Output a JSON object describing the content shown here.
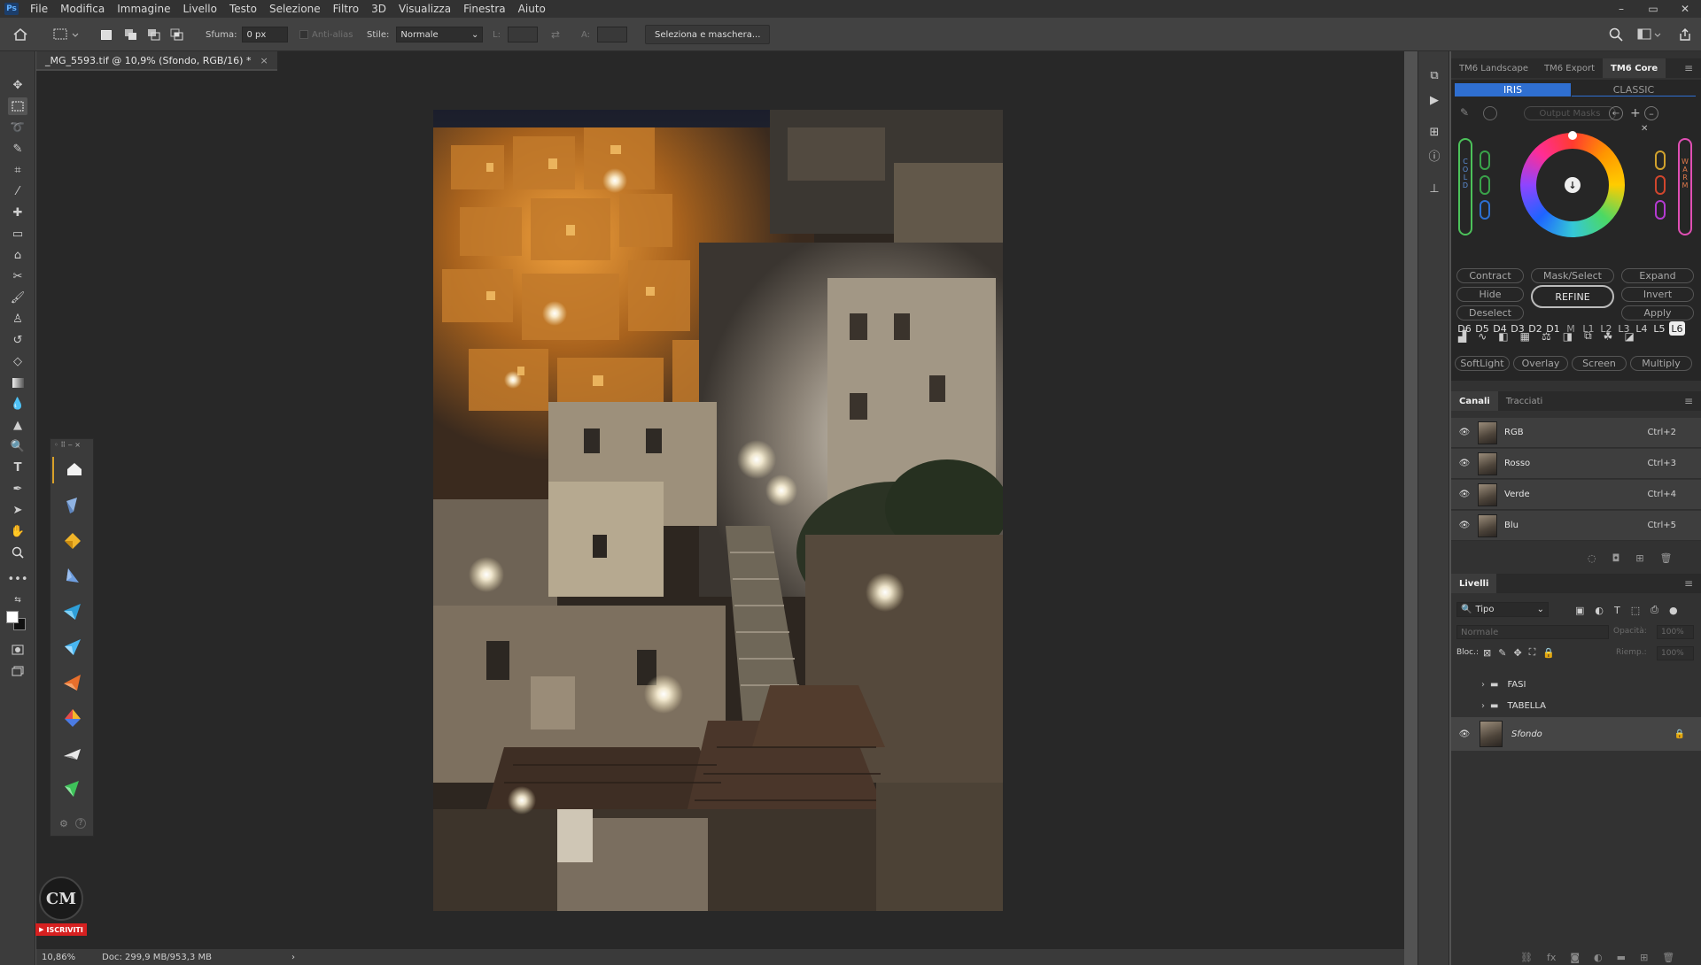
{
  "app": {
    "logo": "Ps"
  },
  "menu": [
    "File",
    "Modifica",
    "Immagine",
    "Livello",
    "Testo",
    "Selezione",
    "Filtro",
    "3D",
    "Visualizza",
    "Finestra",
    "Aiuto"
  ],
  "window_controls": {
    "minimize": "–",
    "restore": "▭",
    "close": "✕"
  },
  "options": {
    "feather_label": "Sfuma:",
    "feather_value": "0 px",
    "antialias_label": "Anti-alias",
    "style_label": "Stile:",
    "style_value": "Normale",
    "width_label": "L:",
    "height_label": "A:",
    "select_mask_button": "Seleziona e maschera..."
  },
  "document": {
    "tab_title": "_MG_5593.tif @ 10,9% (Sfondo, RGB/16) *",
    "tab_close": "×"
  },
  "status": {
    "zoom": "10,86%",
    "doc": "Doc: 299,9 MB/953,3 MB",
    "arrow": "›"
  },
  "floating_panel": {
    "settings": "⚙",
    "help": "?"
  },
  "channel_tag": {
    "subscribe": "ISCRIVITI"
  },
  "tm6": {
    "tabs": [
      "TM6 Landscape",
      "TM6 Export",
      "TM6 Core"
    ],
    "mode_iris": "IRIS",
    "mode_classic": "CLASSIC",
    "output_masks": "Output Masks",
    "cold_label": "C O L D",
    "warm_label": "W A R M",
    "luminosity": [
      "D6",
      "D5",
      "D4",
      "D3",
      "D2",
      "D1",
      "M",
      "L1",
      "L2",
      "L3",
      "L4",
      "L5",
      "L6"
    ],
    "buttons": {
      "contract": "Contract",
      "mask_select": "Mask/Select",
      "expand": "Expand",
      "hide": "Hide",
      "refine": "REFINE",
      "invert": "Invert",
      "deselect": "Deselect",
      "apply": "Apply"
    },
    "blend_modes": [
      "SoftLight",
      "Overlay",
      "Screen",
      "Multiply"
    ]
  },
  "channels": {
    "tabs": [
      "Canali",
      "Tracciati"
    ],
    "rows": [
      {
        "name": "RGB",
        "key": "Ctrl+2"
      },
      {
        "name": "Rosso",
        "key": "Ctrl+3"
      },
      {
        "name": "Verde",
        "key": "Ctrl+4"
      },
      {
        "name": "Blu",
        "key": "Ctrl+5"
      }
    ]
  },
  "layers": {
    "tab": "Livelli",
    "filter": "Tipo",
    "blend": "Normale",
    "opacity_label": "Opacità:",
    "opacity_value": "100%",
    "lock_label": "Bloc.:",
    "fill_label": "Riemp.:",
    "fill_value": "100%",
    "rows": [
      {
        "name": "FASI",
        "type": "group"
      },
      {
        "name": "TABELLA",
        "type": "group"
      },
      {
        "name": "Sfondo",
        "type": "background"
      }
    ]
  },
  "colors": {
    "accent": "#2f6fd1",
    "menubar": "#323232",
    "panel": "#323232"
  }
}
